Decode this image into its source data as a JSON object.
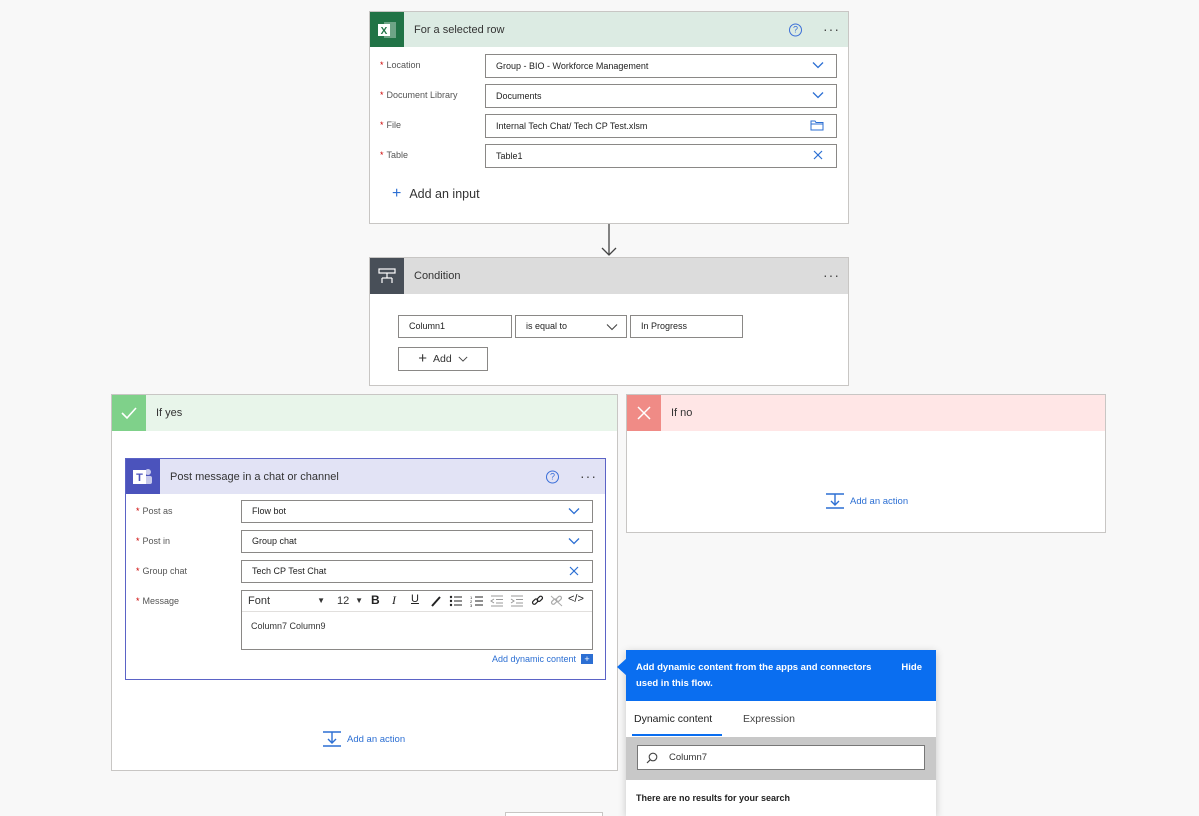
{
  "excel_card": {
    "title": "For a selected row",
    "fields": [
      {
        "label": "Location",
        "value": "Group - BIO - Workforce Management",
        "control": "dropdown"
      },
      {
        "label": "Document Library",
        "value": "Documents",
        "control": "dropdown"
      },
      {
        "label": "File",
        "value": "Internal Tech Chat/ Tech CP Test.xlsm",
        "control": "folder"
      },
      {
        "label": "Table",
        "value": "Table1",
        "control": "clear"
      }
    ],
    "add_input": "Add an input",
    "icon": "excel-icon"
  },
  "condition_card": {
    "title": "Condition",
    "left_operand": "Column1",
    "operator": "is equal to",
    "right_operand": "In Progress",
    "add_label": "Add",
    "icon": "condition-icon"
  },
  "if_yes": {
    "title": "If yes",
    "add_action": "Add an action",
    "teams_card": {
      "title": "Post message in a chat or channel",
      "post_as_label": "Post as",
      "post_as_value": "Flow bot",
      "post_in_label": "Post in",
      "post_in_value": "Group chat",
      "group_chat_label": "Group chat",
      "group_chat_value": "Tech CP Test Chat",
      "message_label": "Message",
      "font": "Font",
      "font_size": "12",
      "message_body": "Column7 Column9",
      "add_dynamic": "Add dynamic content"
    }
  },
  "if_no": {
    "title": "If no",
    "add_action": "Add an action"
  },
  "dynamic_panel": {
    "header_text": "Add dynamic content from the apps and connectors used in this flow.",
    "hide": "Hide",
    "tabs": [
      "Dynamic content",
      "Expression"
    ],
    "search_value": "Column7",
    "no_results": "There are no results for your search"
  },
  "colors": {
    "excel_green": "#217346",
    "excel_header": "#dcebe3",
    "condition_header": "#dcdcdc",
    "condition_icon_bg": "#484f58",
    "yes_header": "#e8f5ea",
    "yes_icon": "#7fd18a",
    "no_header": "#ffe6e6",
    "no_icon": "#f08b86",
    "teams_header": "#e2e3f5",
    "teams_purple": "#4b53bc",
    "accent_blue": "#0a6ef0",
    "link_blue": "#2c6fd3"
  }
}
